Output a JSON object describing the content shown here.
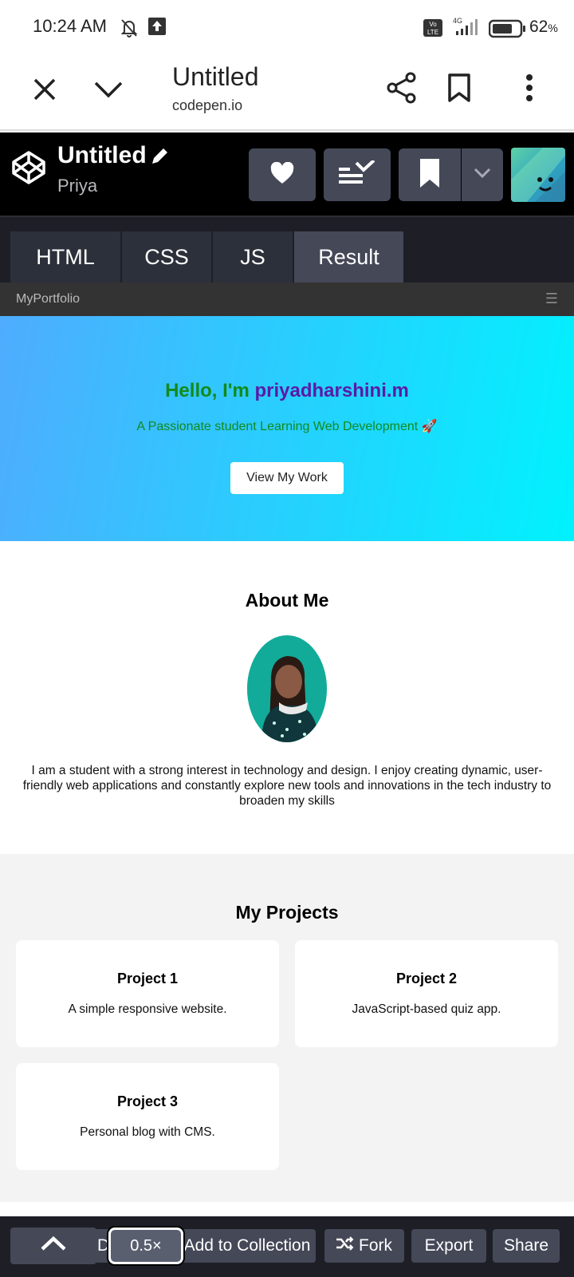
{
  "status_bar": {
    "time": "10:24 AM",
    "battery_percent": "62"
  },
  "browser": {
    "page_title": "Untitled",
    "url": "codepen.io"
  },
  "codepen": {
    "pen_title": "Untitled",
    "author": "Priya",
    "tabs": [
      {
        "label": "HTML",
        "active": false
      },
      {
        "label": "CSS",
        "active": false
      },
      {
        "label": "JS",
        "active": false
      },
      {
        "label": "Result",
        "active": true
      }
    ]
  },
  "site": {
    "brand": "MyPortfolio",
    "menu_icon": "☰",
    "hero": {
      "greeting": "Hello, I'm ",
      "name": "priyadharshini.m",
      "subtitle": "A Passionate student Learning Web Development 🚀",
      "button": "View My Work"
    },
    "about": {
      "title": "About Me",
      "text": "I am a student with a strong interest in technology and design. I enjoy creating dynamic, user-friendly web applications and constantly explore new tools and innovations in the tech industry to broaden my skills"
    },
    "projects": {
      "title": "My Projects",
      "items": [
        {
          "title": "Project 1",
          "desc": "A simple responsive website."
        },
        {
          "title": "Project 2",
          "desc": "JavaScript-based quiz app."
        },
        {
          "title": "Project 3",
          "desc": "Personal blog with CMS."
        }
      ]
    }
  },
  "bottom_bar": {
    "zoom": "0.5×",
    "hidden_label": "D",
    "add_to_collection": "Add to Collection",
    "fork": "Fork",
    "export": "Export",
    "share": "Share"
  },
  "colors": {
    "codepen_bg": "#000000",
    "codepen_button": "#444857",
    "hero_gradient_start": "#4facfe",
    "hero_gradient_end": "#00f2fe",
    "hero_green": "#138a1a",
    "hero_purple": "#5a1aa8"
  },
  "icons": [
    "silent-bell-icon",
    "upload-icon",
    "volte-icon",
    "signal-icon",
    "battery-icon",
    "close-icon",
    "chevron-down-icon",
    "share-icon",
    "bookmark-icon",
    "more-vertical-icon",
    "codepen-logo-icon",
    "pencil-icon",
    "heart-icon",
    "collection-icon",
    "chevron-up-icon",
    "fork-icon"
  ]
}
